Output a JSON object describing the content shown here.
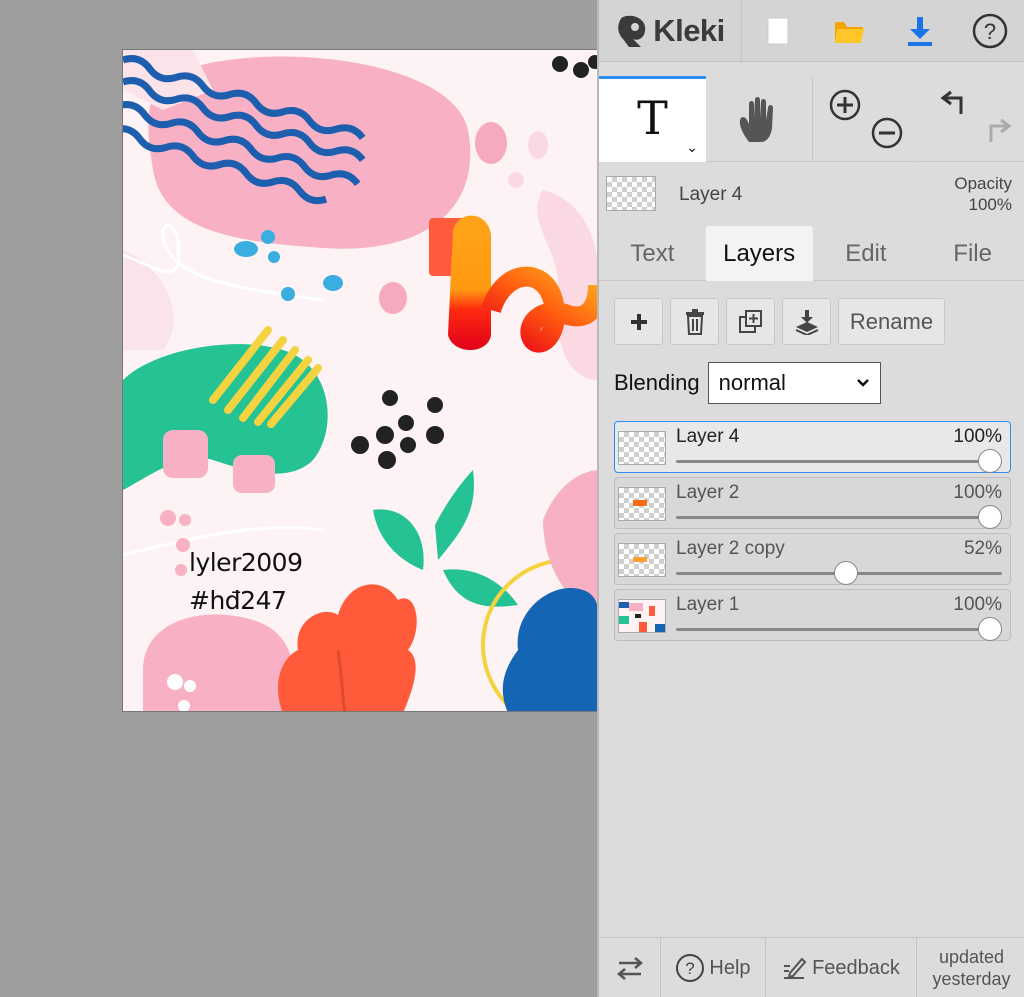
{
  "app": {
    "name": "Kleki"
  },
  "artwork": {
    "caption_line1": "lyler2009",
    "caption_line2": "#hđ247"
  },
  "toolbar": {
    "icons": [
      "new-file-icon",
      "open-folder-icon",
      "download-icon",
      "help-circle-icon"
    ]
  },
  "tools": {
    "text_tool_glyph": "T",
    "hand_tool": "hand-icon",
    "zoom_in": "zoom-in-icon",
    "zoom_out": "zoom-out-icon",
    "undo": "undo-icon",
    "redo": "redo-icon"
  },
  "current_layer": {
    "name": "Layer 4",
    "opacity_label": "Opacity",
    "opacity_value": "100%"
  },
  "tabs": [
    {
      "label": "Text"
    },
    {
      "label": "Layers"
    },
    {
      "label": "Edit"
    },
    {
      "label": "File"
    }
  ],
  "layers_panel": {
    "rename_label": "Rename",
    "blending_label": "Blending",
    "blending_value": "normal",
    "layers": [
      {
        "name": "Layer 4",
        "opacity": "100%",
        "level": 1.0
      },
      {
        "name": "Layer 2",
        "opacity": "100%",
        "level": 1.0
      },
      {
        "name": "Layer 2 copy",
        "opacity": "52%",
        "level": 0.52
      },
      {
        "name": "Layer 1",
        "opacity": "100%",
        "level": 1.0
      }
    ]
  },
  "bottombar": {
    "help_label": "Help",
    "feedback_label": "Feedback",
    "updated_line1": "updated",
    "updated_line2": "yesterday"
  },
  "colors": {
    "accent": "#2a8ff0",
    "panel": "#dcdcdc",
    "workspace": "#9e9e9e"
  }
}
